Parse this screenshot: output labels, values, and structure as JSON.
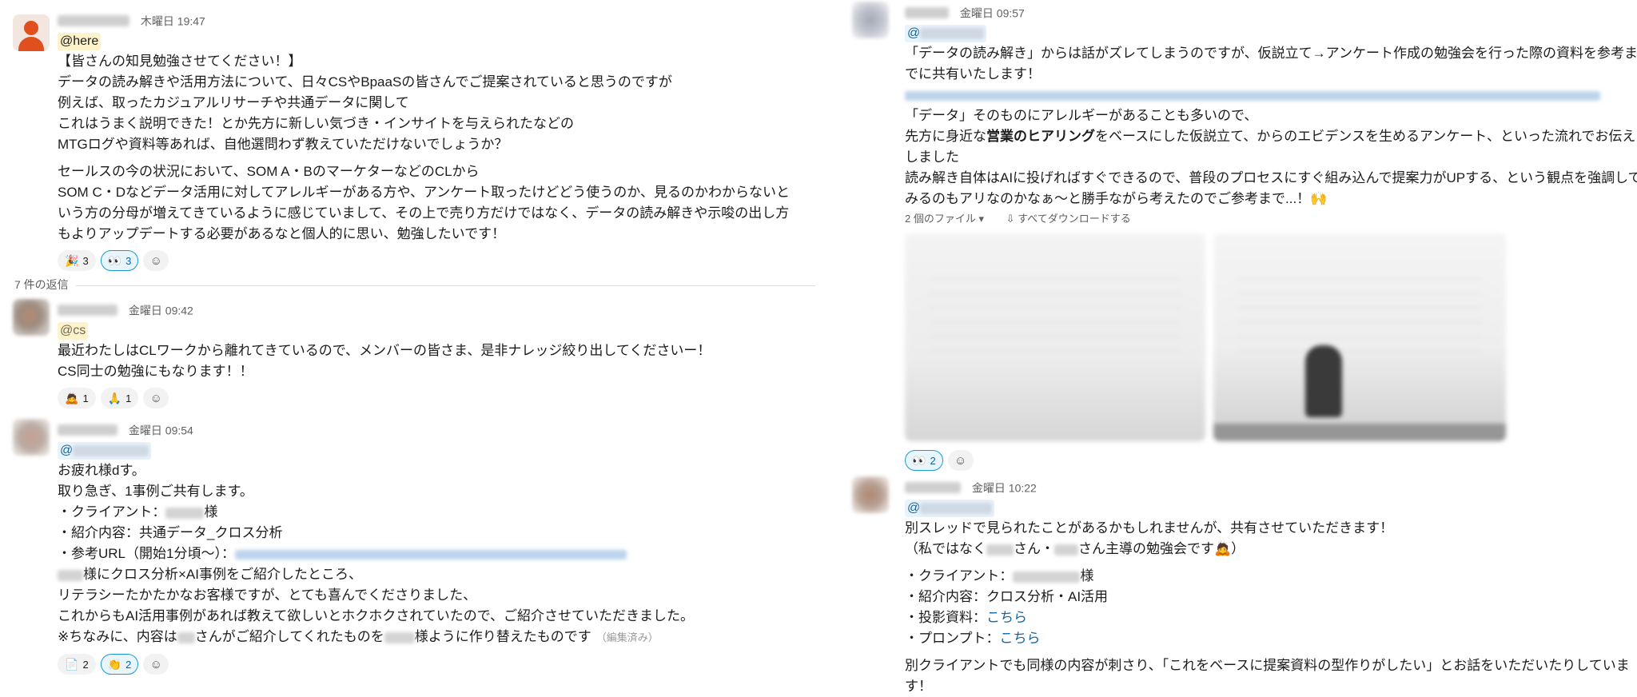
{
  "left": {
    "parent": {
      "timestamp": "木曜日 19:47",
      "mention": "@here",
      "lines": [
        "【皆さんの知見勉強させてください！】",
        "データの読み解きや活用方法について、日々CSやBpaaSの皆さんでご提案されていると思うのですが",
        "例えば、取ったカジュアルリサーチや共通データに関して",
        "これはうまく説明できた！とか先方に新しい気づき・インサイトを与えられたなどの",
        "MTGログや資料等あれば、自他選問わず教えていただけないでしょうか？"
      ],
      "lines2": [
        "セールスの今の状況において、SOM A・BのマーケターなどのCLから",
        "SOM C・Dなどデータ活用に対してアレルギーがある方や、アンケート取ったけどどう使うのか、見るのかわからないと",
        "いう方の分母が増えてきているように感じていまして、その上で売り方だけではなく、データの読み解きや示唆の出し方",
        "もよりアップデートする必要があるなと個人的に思い、勉強したいです！"
      ],
      "reactions": [
        {
          "emoji": "🎉",
          "count": "3",
          "active": false
        },
        {
          "emoji": "👀",
          "count": "3",
          "active": true
        }
      ]
    },
    "replies_label": "7 件の返信",
    "reply1": {
      "timestamp": "金曜日 09:42",
      "mention": "@cs",
      "lines": [
        "最近わたしはCLワークから離れてきているので、メンバーの皆さま、是非ナレッジ絞り出してくださいー！",
        "CS同士の勉強にもなります！！"
      ],
      "reactions": [
        {
          "emoji": "🙇",
          "count": "1",
          "active": false
        },
        {
          "emoji": "🙏",
          "count": "1",
          "active": false
        }
      ]
    },
    "reply2": {
      "timestamp": "金曜日 09:54",
      "mention": "@",
      "l1": "お疲れ様dす。",
      "l2": "取り急ぎ、1事例ご共有します。",
      "l3a": "・クライアント：",
      "l3b": "様",
      "l4": "・紹介内容：共通データ_クロス分析",
      "l5": "・参考URL（開始1分頃〜）：",
      "l6": "様にクロス分析×AI事例をご紹介したところ、",
      "l7": "リテラシーたかたかなお客様ですが、とても喜んでくださりました、",
      "l8": "これからもAI活用事例があれば教えて欲しいとホクホクされていたので、ご紹介させていただきました。",
      "l9a": "※ちなみに、内容は",
      "l9b": "さんがご紹介してくれたものを",
      "l9c": "様ように作り替えたものです",
      "edited": "（編集済み）",
      "reactions": [
        {
          "emoji": "📄",
          "count": "2",
          "active": false
        },
        {
          "emoji": "👏",
          "count": "2",
          "active": true
        }
      ]
    }
  },
  "right": {
    "reply3": {
      "timestamp": "金曜日 09:57",
      "mention": "@",
      "lines": [
        "「データの読み解き」からは話がズレてしまうのですが、仮説立て→アンケート作成の勉強会を行った際の資料を参考ま",
        "でに共有いたします！"
      ],
      "p2a": "「データ」そのものにアレルギーがあることも多いので、",
      "p2b1": "先方に身近な",
      "p2b_bold": "営業のヒアリング",
      "p2b2": "をベースにした仮説立て、からのエビデンスを生めるアンケート、といった流れでお伝え",
      "p2c": "しました",
      "p2d": "読み解き自体はAIに投げればすぐできるので、普段のプロセスにすぐ組み込んで提案力がUPする、という観点を強調して",
      "p2e": "みるのもアリなのかなぁ〜と勝手ながら考えたのでご参考まで...！",
      "files_label": "2 個のファイル",
      "download_label": "すべてダウンロードする",
      "reactions": [
        {
          "emoji": "👀",
          "count": "2",
          "active": true
        }
      ]
    },
    "reply4": {
      "timestamp": "金曜日 10:22",
      "mention": "@",
      "l1": "別スレッドで見られたことがあるかもしれませんが、共有させていただきます！",
      "l2a": "（私ではなく",
      "l2b": "さん・",
      "l2c": "さん主導の勉強会です",
      "l2d": "）",
      "l3a": "・クライアント：",
      "l3b": "様",
      "l4": "・紹介内容：クロス分析・AI活用",
      "l5a": "・投影資料：",
      "l5b": "こちら",
      "l6a": "・プロンプト：",
      "l6b": "こちら",
      "l7": "別クライアントでも同様の内容が刺さり、「これをベースに提案資料の型作りがしたい」とお話をいただいたりしていま",
      "l8": "す！"
    }
  }
}
